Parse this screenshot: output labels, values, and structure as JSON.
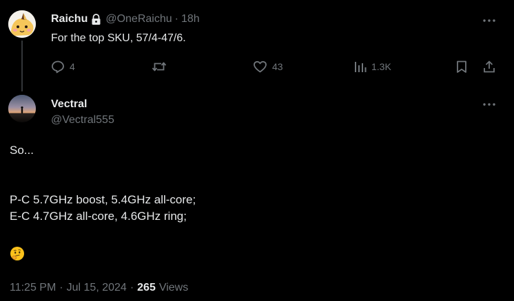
{
  "parent_tweet": {
    "name": "Raichu",
    "handle": "@OneRaichu",
    "separator": "·",
    "time": "18h",
    "text": "For the top SKU, 57/4-47/6.",
    "locked": true,
    "actions": {
      "reply_count": "4",
      "retweet_count": "",
      "like_count": "43",
      "views_count": "1.3K"
    },
    "icons": {
      "lock": "lock-icon",
      "more": "more-icon",
      "reply": "reply-icon",
      "retweet": "retweet-icon",
      "like": "heart-icon",
      "views": "views-chart-icon",
      "bookmark": "bookmark-icon",
      "share": "share-icon"
    }
  },
  "main_tweet": {
    "name": "Vectral",
    "handle": "@Vectral555",
    "lines": [
      "So...",
      "",
      "P-C 5.7GHz boost, 5.4GHz all-core;",
      "E-C 4.7GHz all-core, 4.6GHz ring;"
    ],
    "emoji": "🤔",
    "time": "11:25 PM",
    "separator": "·",
    "date": "Jul 15, 2024",
    "views_count": "265",
    "views_label": "Views"
  },
  "colors": {
    "background": "#000000",
    "text_primary": "#e7e9ea",
    "text_secondary": "#71767b",
    "thread_line": "#333639"
  }
}
